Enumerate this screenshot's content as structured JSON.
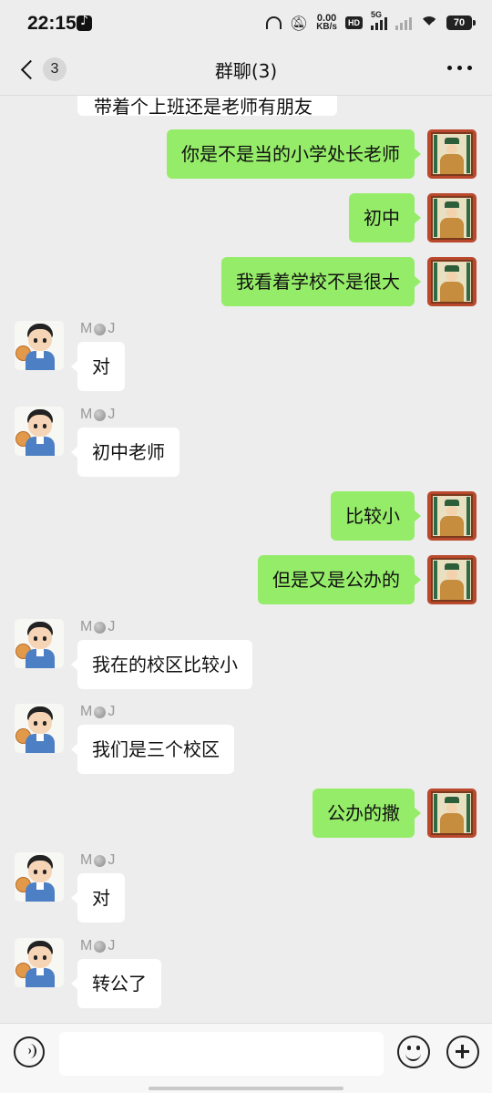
{
  "status_bar": {
    "time": "22:15",
    "network_speed_value": "0.00",
    "network_speed_unit": "KB/s",
    "hd_label": "HD",
    "network_type": "5G",
    "battery": "70"
  },
  "header": {
    "back_badge": "3",
    "title": "群聊(3)"
  },
  "chat": {
    "partial_message": "带着个上班还是老师有朋友",
    "messages": [
      {
        "direction": "out",
        "text": "你是不是当的小学处长老师"
      },
      {
        "direction": "out",
        "text": "初中"
      },
      {
        "direction": "out",
        "text": "我看着学校不是很大"
      },
      {
        "direction": "in",
        "sender_prefix": "M",
        "sender_suffix": "J",
        "text": "对"
      },
      {
        "direction": "in",
        "sender_prefix": "M",
        "sender_suffix": "J",
        "text": "初中老师"
      },
      {
        "direction": "out",
        "text": "比较小"
      },
      {
        "direction": "out",
        "text": "但是又是公办的"
      },
      {
        "direction": "in",
        "sender_prefix": "M",
        "sender_suffix": "J",
        "text": "我在的校区比较小"
      },
      {
        "direction": "in",
        "sender_prefix": "M",
        "sender_suffix": "J",
        "text": "我们是三个校区"
      },
      {
        "direction": "out",
        "text": "公办的撒"
      },
      {
        "direction": "in",
        "sender_prefix": "M",
        "sender_suffix": "J",
        "text": "对"
      },
      {
        "direction": "in",
        "sender_prefix": "M",
        "sender_suffix": "J",
        "text": "转公了"
      }
    ]
  },
  "input_bar": {
    "placeholder": "",
    "value": ""
  },
  "colors": {
    "background": "#ededed",
    "outgoing_bubble": "#95ec69",
    "incoming_bubble": "#ffffff",
    "sender_name": "#999999"
  }
}
